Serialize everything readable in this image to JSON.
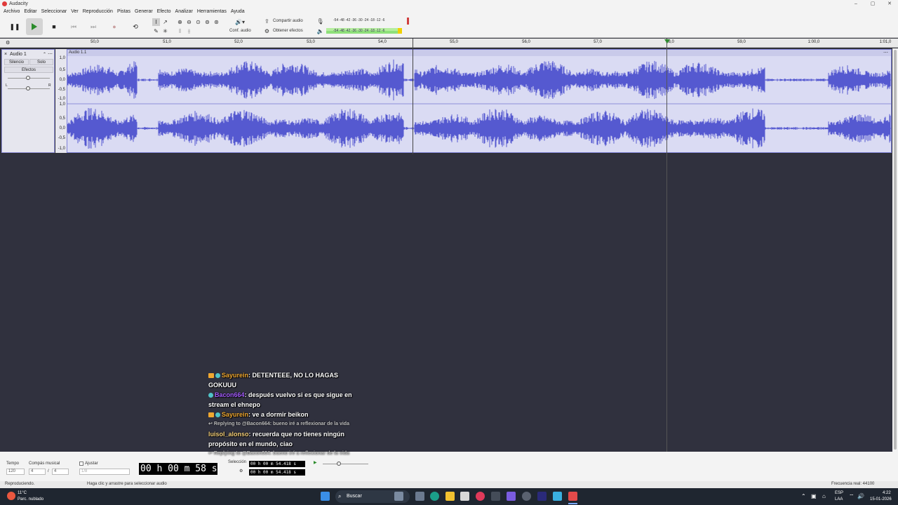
{
  "window": {
    "title": "Audacity"
  },
  "menu": [
    "Archivo",
    "Editar",
    "Seleccionar",
    "Ver",
    "Reproducción",
    "Pistas",
    "Generar",
    "Efecto",
    "Analizar",
    "Herramientas",
    "Ayuda"
  ],
  "toolbar": {
    "audio_setup_label": "Conf. audio",
    "share_audio_label": "Compartir audio",
    "get_effects_label": "Obtener efectos",
    "meter_ticks_record": [
      "-54",
      "-48",
      "-42",
      "-36",
      "-30",
      "-24",
      "-18",
      "-12",
      "-6"
    ],
    "meter_ticks_play": [
      "-54",
      "-48",
      "-42",
      "-36",
      "-30",
      "-24",
      "-18",
      "-12",
      "-6"
    ]
  },
  "ruler": {
    "labels": [
      "50,0",
      "51,0",
      "52,0",
      "53,0",
      "54,0",
      "55,0",
      "56,0",
      "57,0",
      "58,0",
      "59,0",
      "1:00,0",
      "1:01,0"
    ]
  },
  "track": {
    "name": "Audio 1",
    "mute_label": "Silencio",
    "solo_label": "Solo",
    "effects_label": "Efectos",
    "pan_left": "L",
    "pan_right": "R",
    "clip_name": "Audio 1.1",
    "scale_labels": [
      "1,0",
      "0,5",
      "0,0",
      "-0,5",
      "-1,0",
      "1,0",
      "0,5",
      "0,0",
      "-0,5",
      "-1,0"
    ]
  },
  "bottom": {
    "tempo_label": "Tempo",
    "tempo_value": "120",
    "time_sig_label": "Compás musical",
    "time_sig_num": "4",
    "time_sig_den": "4",
    "snap_label": "Ajustar",
    "snap_value": "1/8",
    "time_display": "00 h 00 m 58 s",
    "selection_label": "Selección",
    "sel_start": "00 h 00 m 54.418 s",
    "sel_end": "00 h 00 m 54.418 s"
  },
  "status": {
    "left": "Reproduciendo.",
    "hint": "Haga clic y arrastre para seleccionar audio",
    "rate": "Frecuencia real: 44100"
  },
  "chat": [
    {
      "kind": "msg",
      "user": "Sayurein",
      "color": "#f0a830",
      "text": "DETENTEEE, NO LO HAGAS GOKUUU"
    },
    {
      "kind": "msg",
      "user": "Bacon664",
      "color": "#a45cff",
      "text": "después vuelvo si es que sigue en stream el ehnepo"
    },
    {
      "kind": "msg",
      "user": "Sayurein",
      "color": "#f0a830",
      "text": "ve a dormir beikon"
    },
    {
      "kind": "reply",
      "text": "Replying to @Bacon664: bueno iré a reflexionar de la vida"
    },
    {
      "kind": "msg",
      "user": "luisol_alonso",
      "color": "#f5d07a",
      "text": "recuerda que no tienes ningún propósito en el mundo, ciao"
    },
    {
      "kind": "reply",
      "text": "Replying to @Bacon664: bueno iré a reflexionar de la vida"
    }
  ],
  "taskbar": {
    "weather_temp": "11°C",
    "weather_desc": "Parc. nublado",
    "search_placeholder": "Buscar",
    "lang_top": "ESP",
    "lang_bottom": "LAA",
    "time": "4:22",
    "date": "15-01-2026"
  }
}
